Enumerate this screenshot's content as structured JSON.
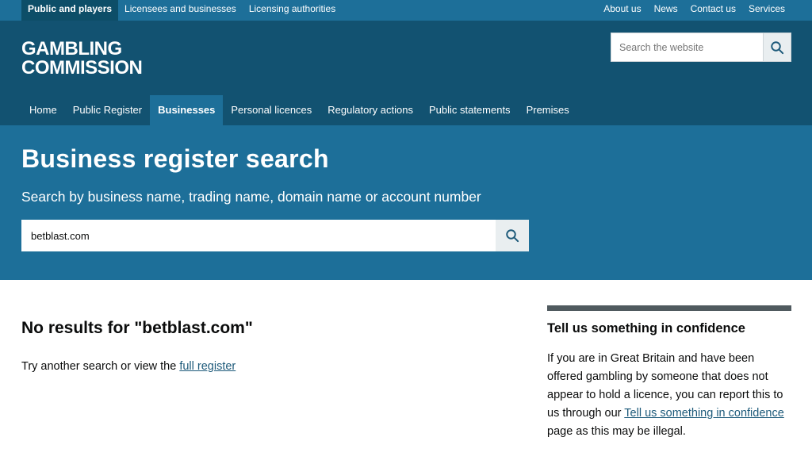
{
  "topbar": {
    "left": [
      "Public and players",
      "Licensees and businesses",
      "Licensing authorities"
    ],
    "right": [
      "About us",
      "News",
      "Contact us",
      "Services"
    ]
  },
  "logo": {
    "line1": "GAMBLING",
    "line2": "COMMISSION"
  },
  "site_search": {
    "placeholder": "Search the website"
  },
  "nav": [
    "Home",
    "Public Register",
    "Businesses",
    "Personal licences",
    "Regulatory actions",
    "Public statements",
    "Premises"
  ],
  "nav_active": "Businesses",
  "hero": {
    "title": "Business register search",
    "subtitle": "Search by business name, trading name, domain name or account number",
    "search_value": "betblast.com"
  },
  "results": {
    "heading": "No results for \"betblast.com\"",
    "text_before": "Try another search or view the ",
    "link": "full register"
  },
  "aside": {
    "heading": "Tell us something in confidence",
    "text_before": "If you are in Great Britain and have been offered gambling by someone that does not appear to hold a licence, you can report this to us through our ",
    "link": "Tell us something in confidence",
    "text_after": " page as this may be illegal."
  },
  "colors": {
    "topbar": "#1d6f99",
    "header": "#125271",
    "hero": "#1d6f99",
    "link": "#1d5a7a"
  }
}
